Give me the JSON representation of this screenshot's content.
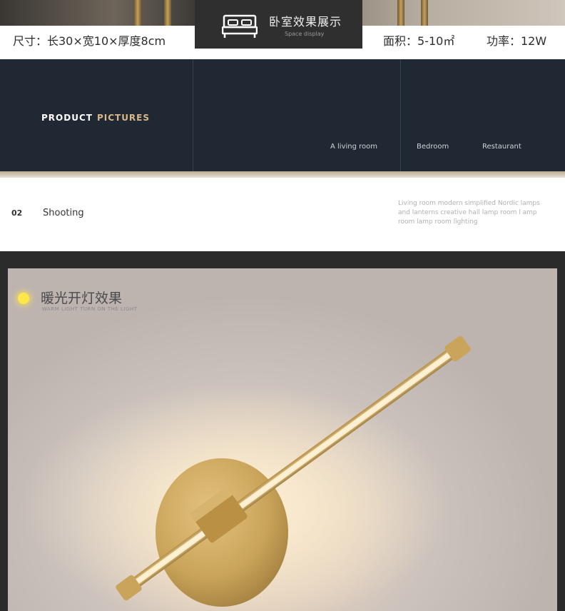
{
  "specs": {
    "size": "尺寸：长30×宽10×厚度8cm",
    "area": "面积：5-10㎡",
    "power": "功率：12W"
  },
  "bedroom_badge": {
    "title": "卧室效果展示",
    "subtitle": "Space display",
    "icon": "bed-icon"
  },
  "product_panel": {
    "title_primary": "PRODUCT",
    "title_accent": "PICTURES",
    "rooms": [
      "A living room",
      "Bedroom",
      "Restaurant"
    ],
    "accent_color": "#d8b98a",
    "background": "#1f2833"
  },
  "shooting": {
    "number": "02",
    "label": "Shooting",
    "description": "Living room modern simplified Nordic lamps and lanterns creative hall lamp room l amp room lamp room lighting"
  },
  "photo": {
    "caption_title": "暖光开灯效果",
    "caption_subtitle": "WARM LIGHT TURN ON THE LIGHT",
    "indicator_color": "#ffe74a",
    "lamp_color": "#c9a45a"
  }
}
